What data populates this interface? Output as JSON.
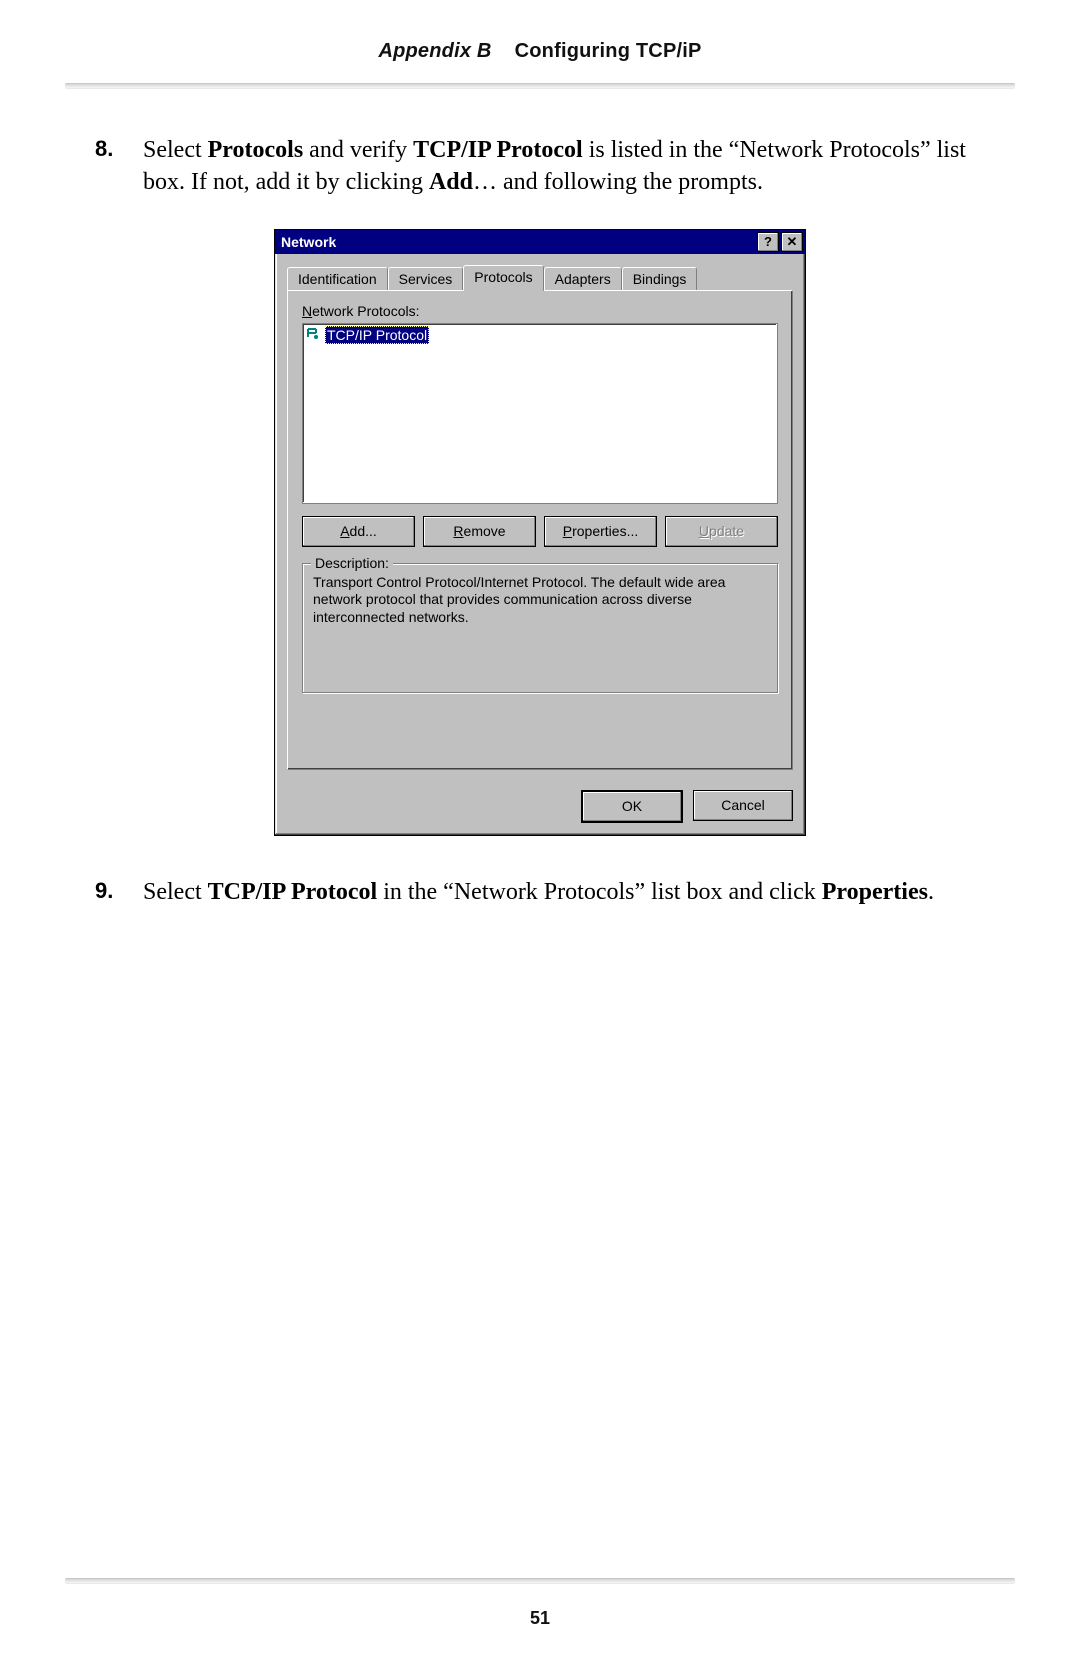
{
  "header": {
    "appendix": "Appendix B",
    "title": "Configuring TCP/iP"
  },
  "steps": {
    "s8": {
      "num": "8.",
      "pre": "Select ",
      "b1": "Protocols",
      "mid1": " and verify ",
      "b2": "TCP/IP Protocol",
      "mid2": " is listed in the “Network Protocols” list box. If not, add it by clicking ",
      "b3": "Add",
      "mid3": "… and following the prompts."
    },
    "s9": {
      "num": "9.",
      "pre": "Select ",
      "b1": "TCP/IP Protocol",
      "mid1": " in the “Network Protocols” list box and click ",
      "b2": "Properties",
      "mid2": "."
    }
  },
  "dialog": {
    "title": "Network",
    "help_glyph": "?",
    "close_glyph": "✕",
    "tabs": [
      "Identification",
      "Services",
      "Protocols",
      "Adapters",
      "Bindings"
    ],
    "active_tab_index": 2,
    "protocols_label_pre": "N",
    "protocols_label_post": "etwork Protocols:",
    "list_item": "TCP/IP Protocol",
    "buttons": {
      "add_u": "A",
      "add_rest": "dd...",
      "remove_u": "R",
      "remove_rest": "emove",
      "props_u": "P",
      "props_rest": "roperties...",
      "update_u": "U",
      "update_rest": "pdate"
    },
    "description_label": "Description:",
    "description_text": "Transport Control Protocol/Internet Protocol. The default wide area network protocol that provides communication across diverse interconnected networks.",
    "ok": "OK",
    "cancel": "Cancel"
  },
  "page_number": "51"
}
